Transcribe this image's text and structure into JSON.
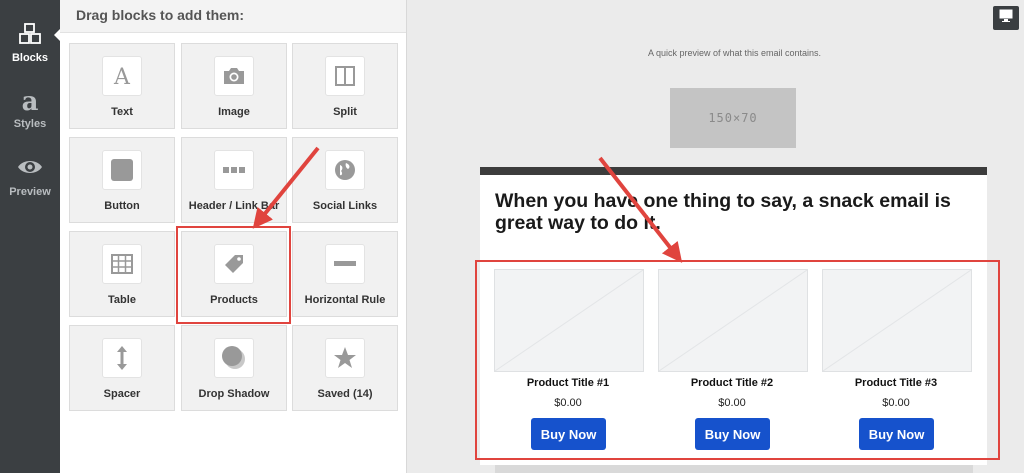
{
  "sidebar": {
    "items": [
      {
        "label": "Blocks",
        "icon": "blocks-icon",
        "active": true
      },
      {
        "label": "Styles",
        "icon": "styles-icon",
        "active": false
      },
      {
        "label": "Preview",
        "icon": "eye-icon",
        "active": false
      }
    ]
  },
  "blocks_panel": {
    "title": "Drag blocks to add them:",
    "tiles": [
      {
        "label": "Text",
        "icon": "text-icon"
      },
      {
        "label": "Image",
        "icon": "camera-icon"
      },
      {
        "label": "Split",
        "icon": "split-icon"
      },
      {
        "label": "Button",
        "icon": "button-icon"
      },
      {
        "label": "Header / Link Bar",
        "icon": "dots-icon"
      },
      {
        "label": "Social Links",
        "icon": "globe-icon"
      },
      {
        "label": "Table",
        "icon": "table-icon"
      },
      {
        "label": "Products",
        "icon": "tag-icon"
      },
      {
        "label": "Horizontal Rule",
        "icon": "horizontal-rule-icon"
      },
      {
        "label": "Spacer",
        "icon": "spacer-icon"
      },
      {
        "label": "Drop Shadow",
        "icon": "drop-shadow-icon"
      },
      {
        "label": "Saved (14)",
        "icon": "star-icon"
      }
    ]
  },
  "preview": {
    "device_icon": "desktop-icon",
    "preheader": "A quick preview of what this email contains.",
    "logo_placeholder": "150×70",
    "heading": "When you have one thing to say, a snack email is great way to do it.",
    "products": [
      {
        "title": "Product Title #1",
        "price": "$0.00",
        "button": "Buy Now"
      },
      {
        "title": "Product Title #2",
        "price": "$0.00",
        "button": "Buy Now"
      },
      {
        "title": "Product Title #3",
        "price": "$0.00",
        "button": "Buy Now"
      }
    ]
  },
  "colors": {
    "rail": "#3b3f42",
    "button": "#1652cc",
    "annotation": "#e0443e"
  }
}
